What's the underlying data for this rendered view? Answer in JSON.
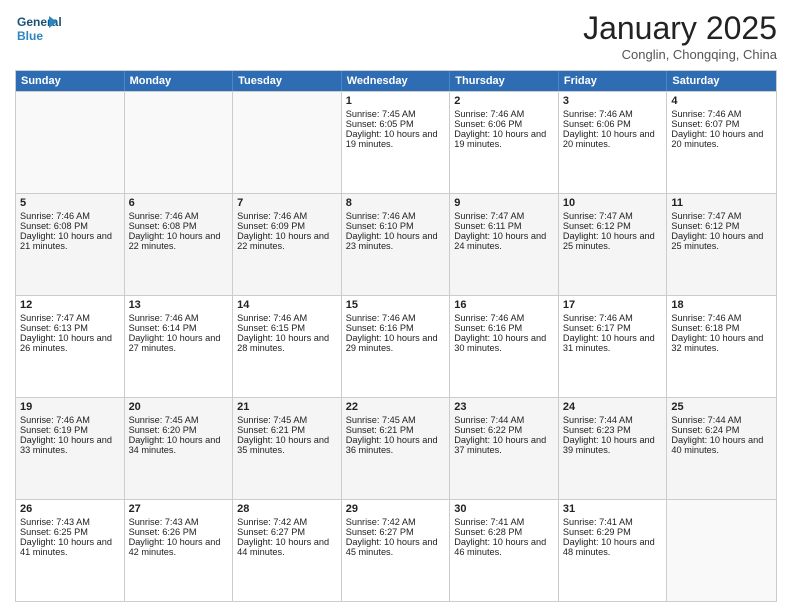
{
  "header": {
    "logo_text_general": "General",
    "logo_text_blue": "Blue",
    "month_year": "January 2025",
    "location": "Conglin, Chongqing, China"
  },
  "calendar": {
    "days_of_week": [
      "Sunday",
      "Monday",
      "Tuesday",
      "Wednesday",
      "Thursday",
      "Friday",
      "Saturday"
    ],
    "weeks": [
      [
        {
          "day": "",
          "sunrise": "",
          "sunset": "",
          "daylight": "",
          "empty": true
        },
        {
          "day": "",
          "sunrise": "",
          "sunset": "",
          "daylight": "",
          "empty": true
        },
        {
          "day": "",
          "sunrise": "",
          "sunset": "",
          "daylight": "",
          "empty": true
        },
        {
          "day": "1",
          "sunrise": "Sunrise: 7:45 AM",
          "sunset": "Sunset: 6:05 PM",
          "daylight": "Daylight: 10 hours and 19 minutes.",
          "empty": false
        },
        {
          "day": "2",
          "sunrise": "Sunrise: 7:46 AM",
          "sunset": "Sunset: 6:06 PM",
          "daylight": "Daylight: 10 hours and 19 minutes.",
          "empty": false
        },
        {
          "day": "3",
          "sunrise": "Sunrise: 7:46 AM",
          "sunset": "Sunset: 6:06 PM",
          "daylight": "Daylight: 10 hours and 20 minutes.",
          "empty": false
        },
        {
          "day": "4",
          "sunrise": "Sunrise: 7:46 AM",
          "sunset": "Sunset: 6:07 PM",
          "daylight": "Daylight: 10 hours and 20 minutes.",
          "empty": false
        }
      ],
      [
        {
          "day": "5",
          "sunrise": "Sunrise: 7:46 AM",
          "sunset": "Sunset: 6:08 PM",
          "daylight": "Daylight: 10 hours and 21 minutes.",
          "empty": false
        },
        {
          "day": "6",
          "sunrise": "Sunrise: 7:46 AM",
          "sunset": "Sunset: 6:08 PM",
          "daylight": "Daylight: 10 hours and 22 minutes.",
          "empty": false
        },
        {
          "day": "7",
          "sunrise": "Sunrise: 7:46 AM",
          "sunset": "Sunset: 6:09 PM",
          "daylight": "Daylight: 10 hours and 22 minutes.",
          "empty": false
        },
        {
          "day": "8",
          "sunrise": "Sunrise: 7:46 AM",
          "sunset": "Sunset: 6:10 PM",
          "daylight": "Daylight: 10 hours and 23 minutes.",
          "empty": false
        },
        {
          "day": "9",
          "sunrise": "Sunrise: 7:47 AM",
          "sunset": "Sunset: 6:11 PM",
          "daylight": "Daylight: 10 hours and 24 minutes.",
          "empty": false
        },
        {
          "day": "10",
          "sunrise": "Sunrise: 7:47 AM",
          "sunset": "Sunset: 6:12 PM",
          "daylight": "Daylight: 10 hours and 25 minutes.",
          "empty": false
        },
        {
          "day": "11",
          "sunrise": "Sunrise: 7:47 AM",
          "sunset": "Sunset: 6:12 PM",
          "daylight": "Daylight: 10 hours and 25 minutes.",
          "empty": false
        }
      ],
      [
        {
          "day": "12",
          "sunrise": "Sunrise: 7:47 AM",
          "sunset": "Sunset: 6:13 PM",
          "daylight": "Daylight: 10 hours and 26 minutes.",
          "empty": false
        },
        {
          "day": "13",
          "sunrise": "Sunrise: 7:46 AM",
          "sunset": "Sunset: 6:14 PM",
          "daylight": "Daylight: 10 hours and 27 minutes.",
          "empty": false
        },
        {
          "day": "14",
          "sunrise": "Sunrise: 7:46 AM",
          "sunset": "Sunset: 6:15 PM",
          "daylight": "Daylight: 10 hours and 28 minutes.",
          "empty": false
        },
        {
          "day": "15",
          "sunrise": "Sunrise: 7:46 AM",
          "sunset": "Sunset: 6:16 PM",
          "daylight": "Daylight: 10 hours and 29 minutes.",
          "empty": false
        },
        {
          "day": "16",
          "sunrise": "Sunrise: 7:46 AM",
          "sunset": "Sunset: 6:16 PM",
          "daylight": "Daylight: 10 hours and 30 minutes.",
          "empty": false
        },
        {
          "day": "17",
          "sunrise": "Sunrise: 7:46 AM",
          "sunset": "Sunset: 6:17 PM",
          "daylight": "Daylight: 10 hours and 31 minutes.",
          "empty": false
        },
        {
          "day": "18",
          "sunrise": "Sunrise: 7:46 AM",
          "sunset": "Sunset: 6:18 PM",
          "daylight": "Daylight: 10 hours and 32 minutes.",
          "empty": false
        }
      ],
      [
        {
          "day": "19",
          "sunrise": "Sunrise: 7:46 AM",
          "sunset": "Sunset: 6:19 PM",
          "daylight": "Daylight: 10 hours and 33 minutes.",
          "empty": false
        },
        {
          "day": "20",
          "sunrise": "Sunrise: 7:45 AM",
          "sunset": "Sunset: 6:20 PM",
          "daylight": "Daylight: 10 hours and 34 minutes.",
          "empty": false
        },
        {
          "day": "21",
          "sunrise": "Sunrise: 7:45 AM",
          "sunset": "Sunset: 6:21 PM",
          "daylight": "Daylight: 10 hours and 35 minutes.",
          "empty": false
        },
        {
          "day": "22",
          "sunrise": "Sunrise: 7:45 AM",
          "sunset": "Sunset: 6:21 PM",
          "daylight": "Daylight: 10 hours and 36 minutes.",
          "empty": false
        },
        {
          "day": "23",
          "sunrise": "Sunrise: 7:44 AM",
          "sunset": "Sunset: 6:22 PM",
          "daylight": "Daylight: 10 hours and 37 minutes.",
          "empty": false
        },
        {
          "day": "24",
          "sunrise": "Sunrise: 7:44 AM",
          "sunset": "Sunset: 6:23 PM",
          "daylight": "Daylight: 10 hours and 39 minutes.",
          "empty": false
        },
        {
          "day": "25",
          "sunrise": "Sunrise: 7:44 AM",
          "sunset": "Sunset: 6:24 PM",
          "daylight": "Daylight: 10 hours and 40 minutes.",
          "empty": false
        }
      ],
      [
        {
          "day": "26",
          "sunrise": "Sunrise: 7:43 AM",
          "sunset": "Sunset: 6:25 PM",
          "daylight": "Daylight: 10 hours and 41 minutes.",
          "empty": false
        },
        {
          "day": "27",
          "sunrise": "Sunrise: 7:43 AM",
          "sunset": "Sunset: 6:26 PM",
          "daylight": "Daylight: 10 hours and 42 minutes.",
          "empty": false
        },
        {
          "day": "28",
          "sunrise": "Sunrise: 7:42 AM",
          "sunset": "Sunset: 6:27 PM",
          "daylight": "Daylight: 10 hours and 44 minutes.",
          "empty": false
        },
        {
          "day": "29",
          "sunrise": "Sunrise: 7:42 AM",
          "sunset": "Sunset: 6:27 PM",
          "daylight": "Daylight: 10 hours and 45 minutes.",
          "empty": false
        },
        {
          "day": "30",
          "sunrise": "Sunrise: 7:41 AM",
          "sunset": "Sunset: 6:28 PM",
          "daylight": "Daylight: 10 hours and 46 minutes.",
          "empty": false
        },
        {
          "day": "31",
          "sunrise": "Sunrise: 7:41 AM",
          "sunset": "Sunset: 6:29 PM",
          "daylight": "Daylight: 10 hours and 48 minutes.",
          "empty": false
        },
        {
          "day": "",
          "sunrise": "",
          "sunset": "",
          "daylight": "",
          "empty": true
        }
      ]
    ]
  }
}
